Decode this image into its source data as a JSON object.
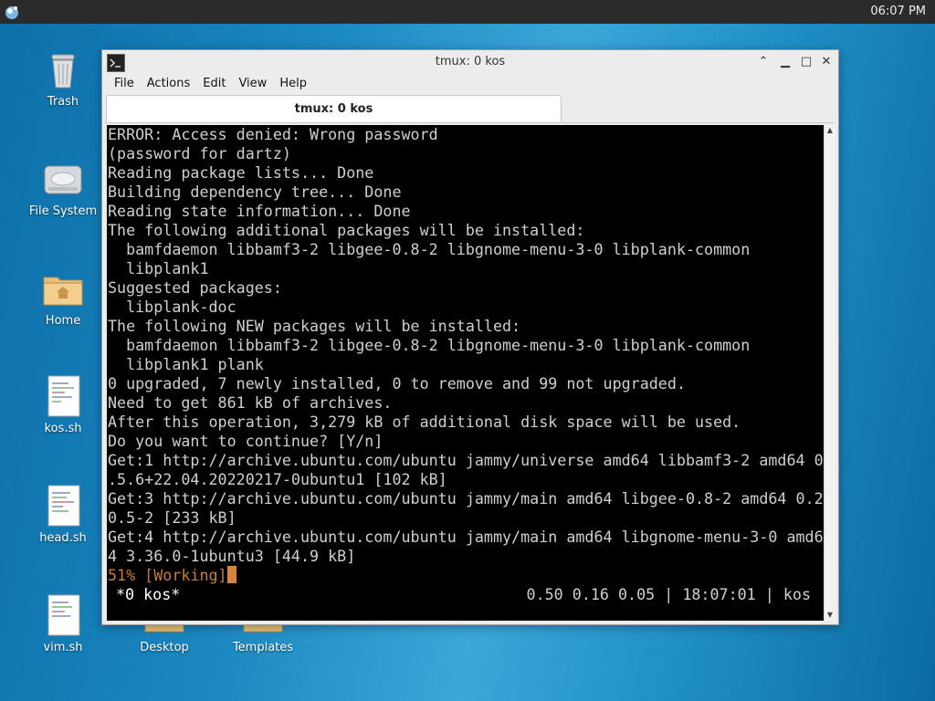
{
  "panel": {
    "clock": "06:07 PM"
  },
  "desktop": {
    "icons": [
      {
        "label": "Trash"
      },
      {
        "label": "File System"
      },
      {
        "label": "Home"
      },
      {
        "label": "kos.sh"
      },
      {
        "label": "head.sh"
      },
      {
        "label": "vim.sh"
      },
      {
        "label": "Desktop"
      },
      {
        "label": "Templates"
      }
    ]
  },
  "window": {
    "title": "tmux: 0 kos",
    "menu": [
      "File",
      "Actions",
      "Edit",
      "View",
      "Help"
    ],
    "tab": "tmux: 0 kos",
    "controls": {
      "shade": "⌃",
      "minimize": "▁",
      "maximize": "□",
      "close": "✕"
    }
  },
  "terminal": {
    "lines": [
      "ERROR: Access denied: Wrong password",
      "(password for dartz)",
      "Reading package lists... Done",
      "Building dependency tree... Done",
      "Reading state information... Done",
      "The following additional packages will be installed:",
      "  bamfdaemon libbamf3-2 libgee-0.8-2 libgnome-menu-3-0 libplank-common",
      "  libplank1",
      "Suggested packages:",
      "  libplank-doc",
      "The following NEW packages will be installed:",
      "  bamfdaemon libbamf3-2 libgee-0.8-2 libgnome-menu-3-0 libplank-common",
      "  libplank1 plank",
      "0 upgraded, 7 newly installed, 0 to remove and 99 not upgraded.",
      "Need to get 861 kB of archives.",
      "After this operation, 3,279 kB of additional disk space will be used.",
      "Do you want to continue? [Y/n]",
      "Get:1 http://archive.ubuntu.com/ubuntu jammy/universe amd64 libbamf3-2 amd64 0",
      ".5.6+22.04.20220217-0ubuntu1 [102 kB]",
      "Get:3 http://archive.ubuntu.com/ubuntu jammy/main amd64 libgee-0.8-2 amd64 0.2",
      "0.5-2 [233 kB]",
      "Get:4 http://archive.ubuntu.com/ubuntu jammy/main amd64 libgnome-menu-3-0 amd6",
      "4 3.36.0-1ubuntu3 [44.9 kB]"
    ],
    "progress": "51% [Working]",
    "status_left": "*0 kos*",
    "status_right": "0.50 0.16 0.05 | 18:07:01 | kos"
  },
  "colors": {
    "accent_progress": "#c87d33",
    "terminal_bg": "#000000"
  }
}
